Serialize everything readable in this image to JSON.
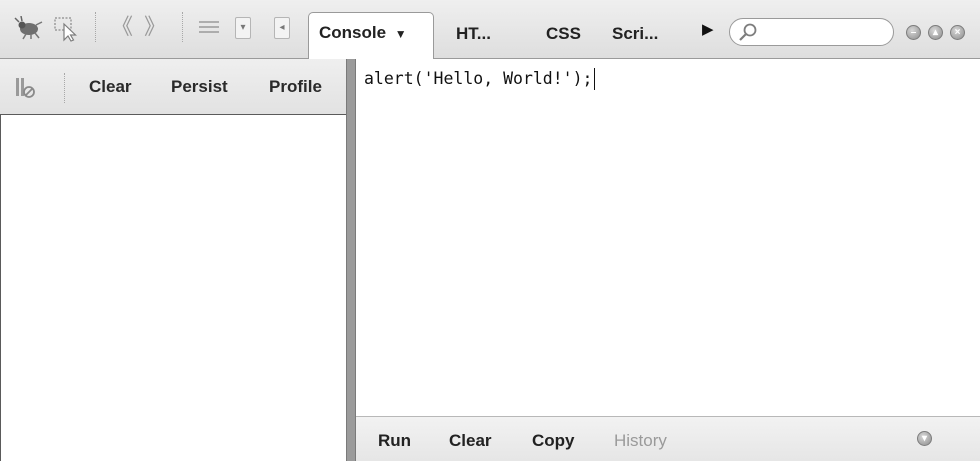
{
  "toolbar": {
    "icons": [
      "firebug-bug-icon",
      "inspect-element-icon",
      "back-icon",
      "forward-icon",
      "list-menu-icon"
    ],
    "tabs": [
      {
        "label": "Console",
        "selected": true,
        "has_dropdown": true
      },
      {
        "label": "HT...",
        "selected": false
      },
      {
        "label": "CSS",
        "selected": false
      },
      {
        "label": "Scri...",
        "selected": false
      }
    ],
    "search": {
      "value": "",
      "placeholder": ""
    },
    "window_buttons": [
      "minimize",
      "detach",
      "close"
    ]
  },
  "log_panel": {
    "buttons": [
      {
        "label": "Clear"
      },
      {
        "label": "Persist"
      },
      {
        "label": "Profile"
      }
    ]
  },
  "command_editor": {
    "code": "alert('Hello, World!');",
    "buttons": [
      {
        "label": "Run",
        "enabled": true
      },
      {
        "label": "Clear",
        "enabled": true
      },
      {
        "label": "Copy",
        "enabled": true
      },
      {
        "label": "History",
        "enabled": false
      }
    ]
  },
  "colors": {
    "toolbar_bg": "#e6e6e6",
    "border_dark": "#5a5a5a",
    "text": "#222222",
    "disabled_text": "#9a9a9a"
  }
}
